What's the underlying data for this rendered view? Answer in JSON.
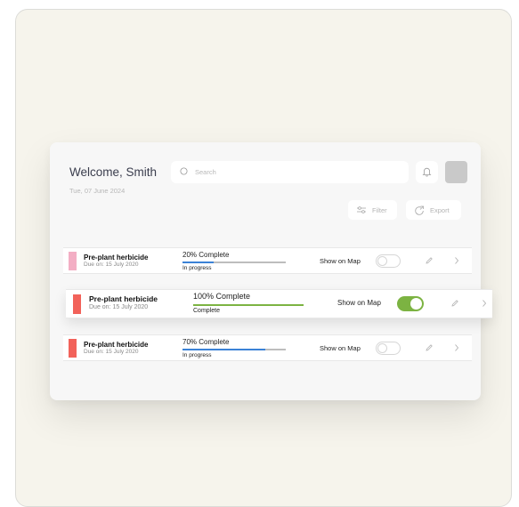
{
  "header": {
    "welcome": "Welcome, Smith",
    "date": "Tue, 07 June 2024",
    "search_placeholder": "Search"
  },
  "toolbar": {
    "filter_label": "Filter",
    "export_label": "Export"
  },
  "tasks": [
    {
      "title": "Pre-plant herbicide",
      "due": "Due on: 15 July 2020",
      "progress_label": "20% Complete",
      "progress": 0.3,
      "status": "In progress",
      "show_on_map_label": "Show on Map",
      "show_on_map": false,
      "swatch_color": "#f3aec4",
      "bar_color": "#3b82d6"
    },
    {
      "title": "Pre-plant herbicide",
      "due": "Due on: 15 July 2020",
      "progress_label": "100% Complete",
      "progress": 1.0,
      "status": "Complete",
      "show_on_map_label": "Show on Map",
      "show_on_map": true,
      "swatch_color": "#f2625a",
      "bar_color": "#7cb342"
    },
    {
      "title": "Pre-plant herbicide",
      "due": "Due on: 15 July 2020",
      "progress_label": "70% Complete",
      "progress": 0.8,
      "status": "In progress",
      "show_on_map_label": "Show on Map",
      "show_on_map": false,
      "swatch_color": "#f2625a",
      "bar_color": "#3b82d6"
    }
  ]
}
